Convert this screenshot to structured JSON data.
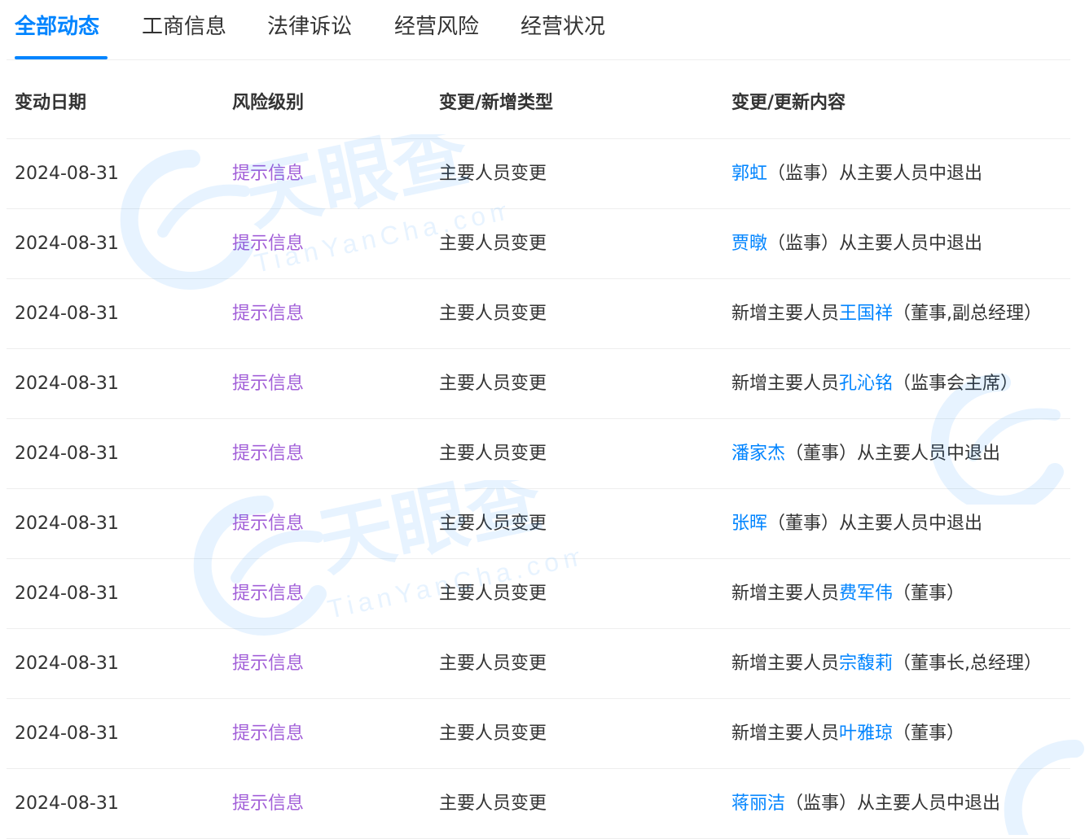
{
  "tabs": [
    {
      "label": "全部动态",
      "active": true
    },
    {
      "label": "工商信息",
      "active": false
    },
    {
      "label": "法律诉讼",
      "active": false
    },
    {
      "label": "经营风险",
      "active": false
    },
    {
      "label": "经营状况",
      "active": false
    }
  ],
  "table": {
    "headers": [
      "变动日期",
      "风险级别",
      "变更/新增类型",
      "变更/更新内容"
    ],
    "rows": [
      {
        "date": "2024-08-31",
        "risk": "提示信息",
        "type": "主要人员变更",
        "prefix": "",
        "name": "郭虹",
        "suffix": "（监事）从主要人员中退出"
      },
      {
        "date": "2024-08-31",
        "risk": "提示信息",
        "type": "主要人员变更",
        "prefix": "",
        "name": "贾暾",
        "suffix": "（监事）从主要人员中退出"
      },
      {
        "date": "2024-08-31",
        "risk": "提示信息",
        "type": "主要人员变更",
        "prefix": "新增主要人员",
        "name": "王国祥",
        "suffix": "（董事,副总经理）"
      },
      {
        "date": "2024-08-31",
        "risk": "提示信息",
        "type": "主要人员变更",
        "prefix": "新增主要人员",
        "name": "孔沁铭",
        "suffix": "（监事会主席）"
      },
      {
        "date": "2024-08-31",
        "risk": "提示信息",
        "type": "主要人员变更",
        "prefix": "",
        "name": "潘家杰",
        "suffix": "（董事）从主要人员中退出"
      },
      {
        "date": "2024-08-31",
        "risk": "提示信息",
        "type": "主要人员变更",
        "prefix": "",
        "name": "张晖",
        "suffix": "（董事）从主要人员中退出"
      },
      {
        "date": "2024-08-31",
        "risk": "提示信息",
        "type": "主要人员变更",
        "prefix": "新增主要人员",
        "name": "费军伟",
        "suffix": "（董事）"
      },
      {
        "date": "2024-08-31",
        "risk": "提示信息",
        "type": "主要人员变更",
        "prefix": "新增主要人员",
        "name": "宗馥莉",
        "suffix": "（董事长,总经理）"
      },
      {
        "date": "2024-08-31",
        "risk": "提示信息",
        "type": "主要人员变更",
        "prefix": "新增主要人员",
        "name": "叶雅琼",
        "suffix": "（董事）"
      },
      {
        "date": "2024-08-31",
        "risk": "提示信息",
        "type": "主要人员变更",
        "prefix": "",
        "name": "蒋丽洁",
        "suffix": "（监事）从主要人员中退出"
      }
    ]
  },
  "watermark": {
    "brand": "天眼查",
    "domain": "TianYanCha.com"
  },
  "colors": {
    "accent": "#0084ff",
    "risk_info": "#a25fd8",
    "text": "#333333",
    "divider": "#eeeeee"
  }
}
